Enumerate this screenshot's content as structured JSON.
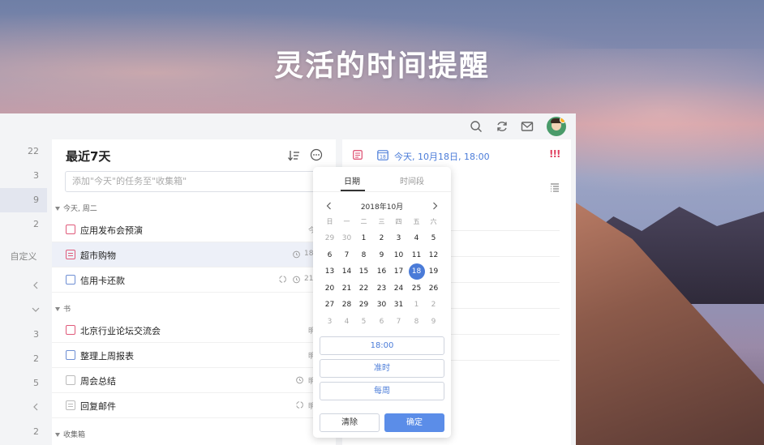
{
  "headline": "灵活的时间提醒",
  "topbar": {
    "icons": [
      "search-icon",
      "sync-icon",
      "mail-icon",
      "avatar"
    ]
  },
  "rail": {
    "counts": [
      "22",
      "3",
      "9",
      "2"
    ],
    "custom_label": "自定义",
    "lower_counts": [
      "3",
      "2",
      "5",
      "2"
    ]
  },
  "list": {
    "title": "最近7天",
    "add_placeholder": "添加\"今天\"的任务至\"收集箱\"",
    "groups": [
      {
        "label": "今天, 周二",
        "tasks": [
          {
            "title": "应用发布会预演",
            "meta": "今",
            "kind": "checkbox",
            "color": "#e05a7a"
          },
          {
            "title": "超市购物",
            "meta": "18",
            "kind": "note",
            "color": "#e05a7a"
          },
          {
            "title": "信用卡还款",
            "meta": "21",
            "kind": "checkbox",
            "color": "#6e8fd4"
          }
        ]
      },
      {
        "label": "书",
        "tasks": [
          {
            "title": "北京行业论坛交流会",
            "meta": "明",
            "kind": "checkbox",
            "color": "#e05a7a"
          },
          {
            "title": "整理上周报表",
            "meta": "明",
            "kind": "checkbox",
            "color": "#6e8fd4"
          },
          {
            "title": "周会总结",
            "meta": "明",
            "kind": "checkbox",
            "color": "#bbbbbb"
          },
          {
            "title": "回复邮件",
            "meta": "明",
            "kind": "note",
            "color": "#bbbbbb"
          }
        ]
      },
      {
        "label": "收集箱",
        "tasks": []
      }
    ]
  },
  "detail": {
    "date_text": "今天, 10月18日, 18:00",
    "calendar_day": "18",
    "priority": "!!!"
  },
  "picker": {
    "tabs": [
      "日期",
      "时间段"
    ],
    "month": "2018年10月",
    "weekdays": [
      "日",
      "一",
      "二",
      "三",
      "四",
      "五",
      "六"
    ],
    "weeks": [
      [
        "29",
        "30",
        "1",
        "2",
        "3",
        "4",
        "5"
      ],
      [
        "6",
        "7",
        "8",
        "9",
        "10",
        "11",
        "12"
      ],
      [
        "13",
        "14",
        "15",
        "16",
        "17",
        "18",
        "19"
      ],
      [
        "20",
        "21",
        "22",
        "23",
        "24",
        "25",
        "26"
      ],
      [
        "27",
        "28",
        "29",
        "30",
        "31",
        "1",
        "2"
      ],
      [
        "3",
        "4",
        "5",
        "6",
        "7",
        "8",
        "9"
      ]
    ],
    "selected_day": "18",
    "time": "18:00",
    "reminder": "准时",
    "repeat": "每周",
    "clear": "清除",
    "confirm": "确定",
    "accent": "#4a7bd8"
  }
}
